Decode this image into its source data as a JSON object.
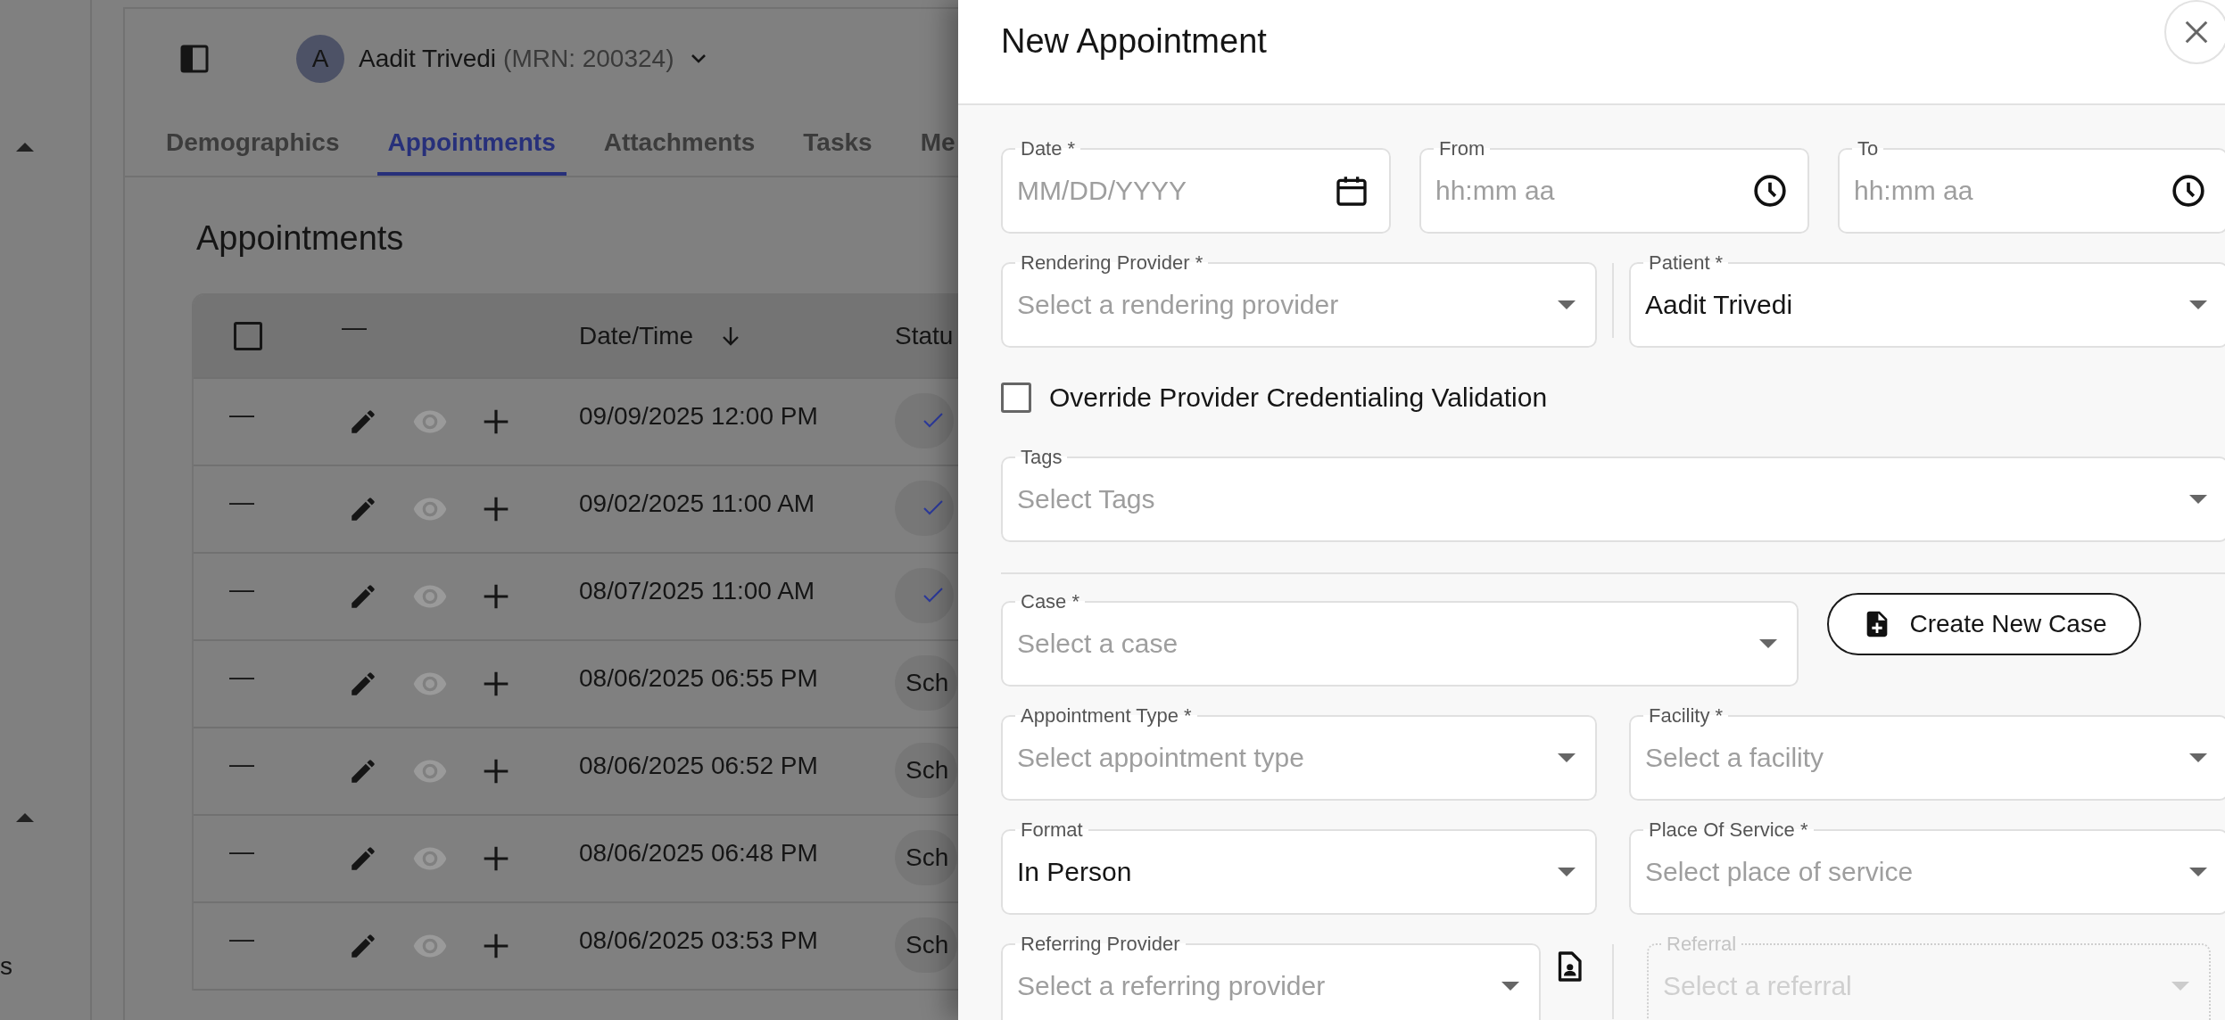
{
  "sidebar": {
    "label": "s"
  },
  "patient": {
    "avatar": "A",
    "name": "Aadit Trivedi",
    "mrn": "(MRN: 200324)"
  },
  "tabs": [
    {
      "label": "Demographics",
      "selected": false
    },
    {
      "label": "Appointments",
      "selected": true
    },
    {
      "label": "Attachments",
      "selected": false
    },
    {
      "label": "Tasks",
      "selected": false
    },
    {
      "label": "Me",
      "selected": false
    }
  ],
  "appointments": {
    "title": "Appointments",
    "columns": [
      {
        "kind": "checkbox",
        "checked": false
      },
      {
        "kind": "text",
        "label": "—"
      },
      {
        "kind": "sort",
        "label": "Date/Time"
      },
      {
        "kind": "text",
        "label": "Statu"
      }
    ],
    "rows": [
      {
        "marker": "—",
        "datetime": "09/09/2025 12:00 PM",
        "status": {
          "kind": "check"
        }
      },
      {
        "marker": "—",
        "datetime": "09/02/2025 11:00 AM",
        "status": {
          "kind": "check"
        }
      },
      {
        "marker": "—",
        "datetime": "08/07/2025 11:00 AM",
        "status": {
          "kind": "check"
        }
      },
      {
        "marker": "—",
        "datetime": "08/06/2025 06:55 PM",
        "status": {
          "kind": "text",
          "label": "Sch"
        }
      },
      {
        "marker": "—",
        "datetime": "08/06/2025 06:52 PM",
        "status": {
          "kind": "text",
          "label": "Sch"
        }
      },
      {
        "marker": "—",
        "datetime": "08/06/2025 06:48 PM",
        "status": {
          "kind": "text",
          "label": "Sch"
        }
      },
      {
        "marker": "—",
        "datetime": "08/06/2025 03:53 PM",
        "status": {
          "kind": "text",
          "label": "Sch"
        }
      }
    ]
  },
  "drawer": {
    "title": "New Appointment",
    "rows": [
      {
        "kind": "fields",
        "fields": [
          {
            "kind": "date",
            "label": "Date *",
            "placeholder": "MM/DD/YYYY",
            "disabled": false
          },
          {
            "kind": "time",
            "label": "From",
            "placeholder": "hh:mm aa",
            "disabled": false
          },
          {
            "kind": "time",
            "label": "To",
            "placeholder": "hh:mm aa",
            "disabled": false
          }
        ]
      },
      {
        "kind": "fields",
        "divider": true,
        "fields": [
          {
            "kind": "select",
            "label": "Rendering Provider *",
            "placeholder": "Select a rendering provider",
            "disabled": false
          },
          {
            "kind": "select",
            "label": "Patient *",
            "value": "Aadit Trivedi",
            "disabled": false
          }
        ]
      },
      {
        "kind": "checkbox",
        "label": "Override Provider Credentialing Validation",
        "checked": false
      },
      {
        "kind": "fields",
        "fields": [
          {
            "kind": "select",
            "label": "Tags",
            "placeholder": "Select Tags",
            "disabled": false
          }
        ]
      },
      {
        "kind": "rule"
      },
      {
        "kind": "case",
        "button": "Create New Case",
        "fields": [
          {
            "kind": "select",
            "label": "Case *",
            "placeholder": "Select a case",
            "disabled": false
          }
        ]
      },
      {
        "kind": "fields",
        "divider": false,
        "fields": [
          {
            "kind": "select",
            "label": "Appointment Type *",
            "placeholder": "Select appointment type",
            "disabled": false
          },
          {
            "kind": "select",
            "label": "Facility *",
            "placeholder": "Select a facility",
            "disabled": false
          }
        ]
      },
      {
        "kind": "fields",
        "divider": false,
        "fields": [
          {
            "kind": "select",
            "label": "Format",
            "value": "In Person",
            "disabled": false
          },
          {
            "kind": "select",
            "label": "Place Of Service *",
            "placeholder": "Select place of service",
            "disabled": false
          }
        ]
      },
      {
        "kind": "referral",
        "fields": [
          {
            "kind": "select",
            "label": "Referring Provider",
            "placeholder": "Select a referring provider",
            "disabled": false
          },
          {
            "kind": "select",
            "label": "Referral",
            "placeholder": "Select a referral",
            "disabled": true
          }
        ]
      }
    ]
  }
}
